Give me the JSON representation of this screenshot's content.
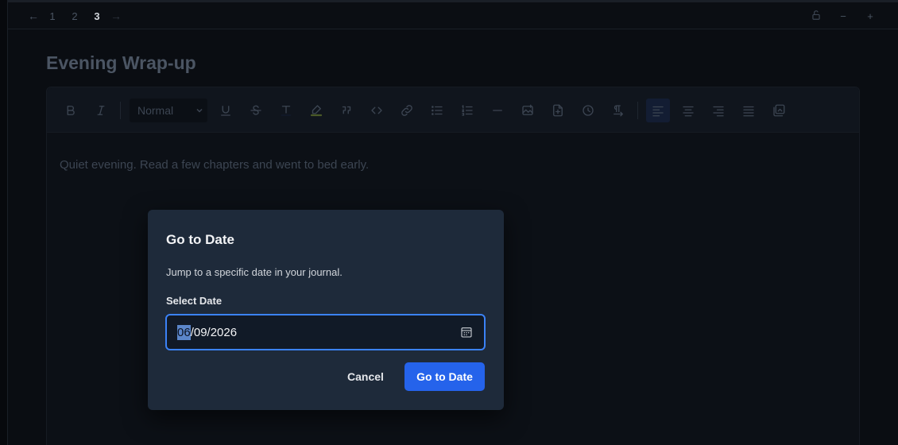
{
  "topbar": {
    "back_icon": "←",
    "pages": [
      "1",
      "2",
      "3"
    ],
    "active_page": "3",
    "forward_icon": "→",
    "right_controls": [
      "lock-icon",
      "zoom-out",
      "zoom-in"
    ],
    "zoom_out_label": "−",
    "zoom_in_label": "+"
  },
  "entry": {
    "title": "Evening Wrap-up",
    "body": "Quiet evening. Read a few chapters and went to bed early."
  },
  "toolbar": {
    "format_select_value": "Normal",
    "buttons": [
      "bold-icon",
      "italic-icon",
      "underline-icon",
      "strikethrough-icon",
      "text-color-icon",
      "highlight-icon",
      "quote-icon",
      "code-icon",
      "link-icon",
      "bullet-list-icon",
      "numbered-list-icon",
      "horizontal-rule-icon",
      "image-icon",
      "file-icon",
      "clock-icon",
      "text-direction-icon",
      "align-left-icon",
      "align-center-icon",
      "align-right-icon",
      "align-justify-icon",
      "embed-icon"
    ],
    "active_button": "align-left-icon"
  },
  "dialog": {
    "title": "Go to Date",
    "description": "Jump to a specific date in your journal.",
    "field_label": "Select Date",
    "date_month": "06",
    "date_rest": "/09/2026",
    "cancel_label": "Cancel",
    "confirm_label": "Go to Date"
  },
  "colors": {
    "accent": "#2563eb",
    "focus_border": "#3b82f6",
    "dialog_bg": "#1e2a3a",
    "page_bg": "#0a0d12"
  }
}
